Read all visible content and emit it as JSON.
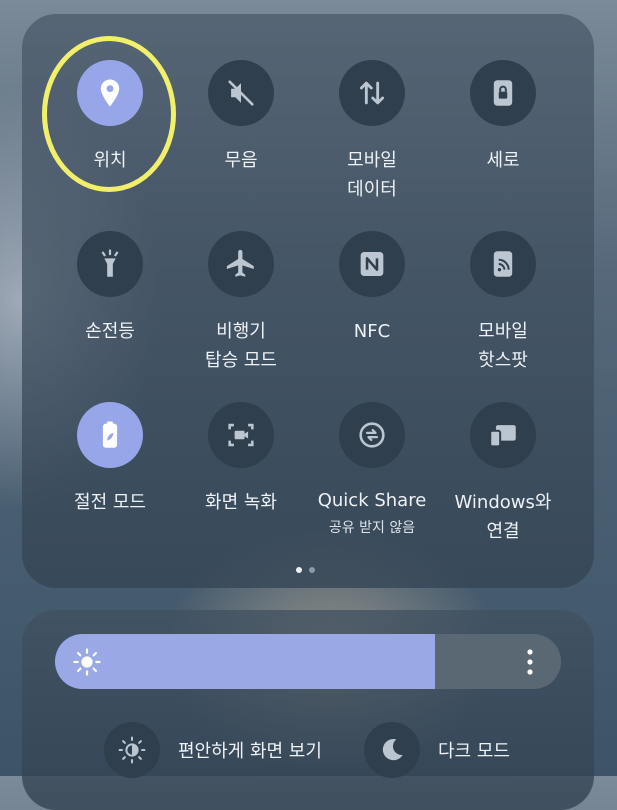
{
  "quick_settings": {
    "tiles": [
      {
        "label": "위치",
        "active": true,
        "icon": "location-pin-icon"
      },
      {
        "label": "무음",
        "active": false,
        "icon": "mute-speaker-icon"
      },
      {
        "label": "모바일\n데이터",
        "active": false,
        "icon": "data-arrows-icon"
      },
      {
        "label": "세로",
        "active": false,
        "icon": "portrait-lock-icon"
      },
      {
        "label": "손전등",
        "active": false,
        "icon": "flashlight-icon"
      },
      {
        "label": "비행기\n탑승 모드",
        "active": false,
        "icon": "airplane-icon"
      },
      {
        "label": "NFC",
        "active": false,
        "icon": "nfc-icon"
      },
      {
        "label": "모바일\n핫스팟",
        "active": false,
        "icon": "hotspot-icon"
      },
      {
        "label": "절전 모드",
        "active": true,
        "icon": "battery-saver-icon"
      },
      {
        "label": "화면 녹화",
        "active": false,
        "icon": "screen-record-icon"
      },
      {
        "label": "Quick Share",
        "sublabel": "공유 받지 않음",
        "active": false,
        "icon": "quick-share-icon"
      },
      {
        "label": "Windows와\n연결",
        "active": false,
        "icon": "link-to-windows-icon"
      }
    ],
    "page_indicator": {
      "current": 1,
      "total": 2
    }
  },
  "brightness": {
    "level_percent": 75,
    "icon": "sun-icon",
    "more_icon": "more-vertical-icon"
  },
  "bottom_buttons": {
    "eye_comfort": {
      "label": "편안하게 화면 보기",
      "icon": "eye-comfort-icon"
    },
    "dark_mode": {
      "label": "다크 모드",
      "icon": "moon-icon"
    }
  },
  "colors": {
    "accent": "#96a6e8",
    "highlight_ring": "#f2f06a"
  }
}
